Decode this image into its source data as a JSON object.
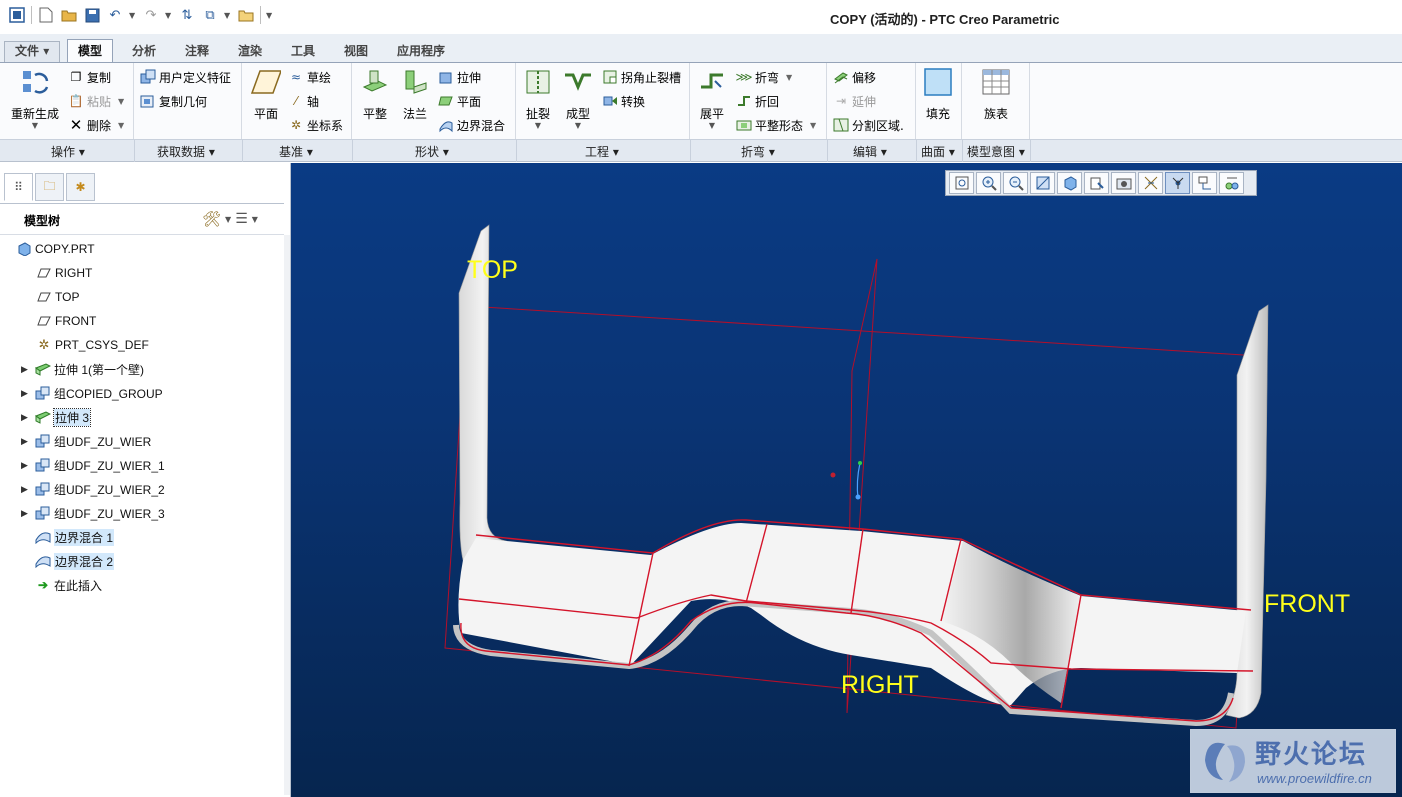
{
  "window": {
    "title": "COPY (活动的) - PTC Creo Parametric"
  },
  "ribbon": {
    "tabs": [
      {
        "label": "文件",
        "key": "file"
      },
      {
        "label": "模型",
        "key": "model"
      },
      {
        "label": "分析",
        "key": "analysis"
      },
      {
        "label": "注释",
        "key": "annotate"
      },
      {
        "label": "渲染",
        "key": "render"
      },
      {
        "label": "工具",
        "key": "tools"
      },
      {
        "label": "视图",
        "key": "view"
      },
      {
        "label": "应用程序",
        "key": "apps"
      }
    ],
    "active_tab": "模型",
    "buttons": {
      "regenerate": "重新生成",
      "copy": "复制",
      "paste": "粘贴",
      "delete": "删除",
      "user_defined_feature": "用户定义特征",
      "copy_geometry": "复制几何",
      "plane": "平面",
      "sketch": "草绘",
      "axis": "轴",
      "csys": "坐标系",
      "flat": "平整",
      "flange": "法兰",
      "extrude": "拉伸",
      "planar": "平面",
      "boundary_blend": "边界混合",
      "rip": "扯裂",
      "form": "成型",
      "corner_relief": "拐角止裂槽",
      "convert": "转换",
      "unbend": "展平",
      "bend": "折弯",
      "bend_back": "折回",
      "flatten": "平整形态",
      "offset": "偏移",
      "extend": "延伸",
      "split_area": "分割区域.",
      "fill": "填充",
      "family_table": "族表"
    },
    "groups": {
      "operations": "操作",
      "get_data": "获取数据",
      "datum": "基准",
      "shapes": "形状",
      "engineering": "工程",
      "bends": "折弯",
      "editing": "编辑",
      "surfaces": "曲面",
      "model_intent": "模型意图"
    }
  },
  "model_tree": {
    "title": "模型树",
    "items": [
      {
        "label": "COPY.PRT",
        "icon": "part-icon",
        "expandable": false,
        "indent": 0
      },
      {
        "label": "RIGHT",
        "icon": "datum-plane-icon",
        "expandable": false,
        "indent": 1
      },
      {
        "label": "TOP",
        "icon": "datum-plane-icon",
        "expandable": false,
        "indent": 1
      },
      {
        "label": "FRONT",
        "icon": "datum-plane-icon",
        "expandable": false,
        "indent": 1
      },
      {
        "label": "PRT_CSYS_DEF",
        "icon": "csys-icon",
        "expandable": false,
        "indent": 1
      },
      {
        "label": "拉伸 1(第一个壁)",
        "icon": "extrude-wall-icon",
        "expandable": true,
        "indent": 1
      },
      {
        "label": "组COPIED_GROUP",
        "icon": "group-icon",
        "expandable": true,
        "indent": 1
      },
      {
        "label": "拉伸 3",
        "icon": "extrude-wall-icon",
        "expandable": true,
        "indent": 1,
        "selected": true,
        "focused": true
      },
      {
        "label": "组UDF_ZU_WIER",
        "icon": "group-icon",
        "expandable": true,
        "indent": 1
      },
      {
        "label": "组UDF_ZU_WIER_1",
        "icon": "group-icon",
        "expandable": true,
        "indent": 1
      },
      {
        "label": "组UDF_ZU_WIER_2",
        "icon": "group-icon",
        "expandable": true,
        "indent": 1
      },
      {
        "label": "组UDF_ZU_WIER_3",
        "icon": "group-icon",
        "expandable": true,
        "indent": 1
      },
      {
        "label": "边界混合 1",
        "icon": "boundary-blend-icon",
        "expandable": false,
        "indent": 1,
        "selected": true
      },
      {
        "label": "边界混合 2",
        "icon": "boundary-blend-icon",
        "expandable": false,
        "indent": 1,
        "selected": true
      },
      {
        "label": "在此插入",
        "icon": "insert-here-arrow-icon",
        "expandable": false,
        "indent": 1
      }
    ]
  },
  "viewport": {
    "datum_labels": {
      "top": "TOP",
      "front": "FRONT",
      "right": "RIGHT"
    },
    "colors": {
      "background": "#0a3577",
      "datum_label": "#ffff1a",
      "edge": "#d4142a",
      "part_surface": "#f4f4f4"
    }
  },
  "watermark": {
    "text": "野火论坛",
    "url": "www.proewildfire.cn"
  }
}
